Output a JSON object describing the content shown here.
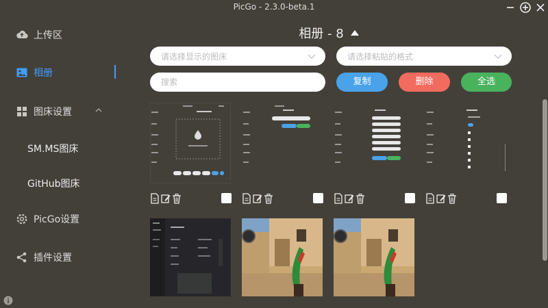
{
  "window": {
    "title": "PicGo - 2.3.0-beta.1"
  },
  "sidebar": {
    "items": [
      {
        "label": "上传区",
        "icon": "upload-cloud-icon"
      },
      {
        "label": "相册",
        "icon": "image-icon",
        "active": true
      },
      {
        "label": "图床设置",
        "icon": "grid-icon"
      },
      {
        "label": "SM.MS图床"
      },
      {
        "label": "GitHub图床"
      },
      {
        "label": "PicGo设置",
        "icon": "gear-icon"
      },
      {
        "label": "插件设置",
        "icon": "share-icon"
      }
    ]
  },
  "gallery": {
    "title": "相册 - 8",
    "filter_placeholder": "请选择显示的图床",
    "paste_format_placeholder": "请选择粘贴的格式",
    "search_placeholder": "搜索",
    "copy_label": "复制",
    "delete_label": "删除",
    "select_all_label": "全选",
    "image_count": 8
  },
  "colors": {
    "background": "#434039",
    "accent": "#409eff",
    "copy": "#4aa2e8",
    "delete": "#f26b5f",
    "select_all": "#49b25d"
  }
}
